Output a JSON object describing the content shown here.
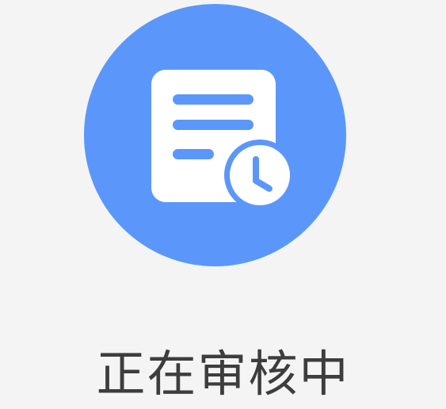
{
  "status": {
    "icon": "document-pending-clock-icon",
    "accent_color": "#5b97fb",
    "label": "正在审核中"
  }
}
